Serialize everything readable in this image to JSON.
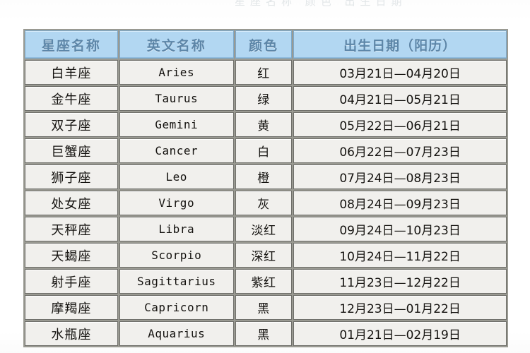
{
  "page": {
    "background_color": "#ffffff",
    "faint_top_text": "星座名称  颜色  出生日期"
  },
  "table": {
    "name": "zodiac-reference-table",
    "header_background_color": "#b2d7f2",
    "header_text_color": "#5d86a8",
    "cell_background_color": "#f1f0ed",
    "cell_text_color": "#14120f",
    "border_color": "#6f6f6a",
    "columns": [
      {
        "key": "name",
        "label": "星座名称"
      },
      {
        "key": "en",
        "label": "英文名称"
      },
      {
        "key": "color",
        "label": "颜色"
      },
      {
        "key": "date",
        "label": "出生日期（阳历）"
      }
    ],
    "rows": [
      {
        "name": "白羊座",
        "en": "Aries",
        "color": "红",
        "date": "03月21日—04月20日"
      },
      {
        "name": "金牛座",
        "en": "Taurus",
        "color": "绿",
        "date": "04月21日—05月21日"
      },
      {
        "name": "双子座",
        "en": "Gemini",
        "color": "黄",
        "date": "05月22日—06月21日"
      },
      {
        "name": "巨蟹座",
        "en": "Cancer",
        "color": "白",
        "date": "06月22日—07月23日"
      },
      {
        "name": "狮子座",
        "en": "Leo",
        "color": "橙",
        "date": "07月24日—08月23日"
      },
      {
        "name": "处女座",
        "en": "Virgo",
        "color": "灰",
        "date": "08月24日—09月23日"
      },
      {
        "name": "天秤座",
        "en": "Libra",
        "color": "淡红",
        "date": "09月24日—10月23日"
      },
      {
        "name": "天蝎座",
        "en": "Scorpio",
        "color": "深红",
        "date": "10月24日—11月22日"
      },
      {
        "name": "射手座",
        "en": "Sagittarius",
        "color": "紫红",
        "date": "11月23日—12月22日"
      },
      {
        "name": "摩羯座",
        "en": "Capricorn",
        "color": "黑",
        "date": "12月23日—01月22日"
      },
      {
        "name": "水瓶座",
        "en": "Aquarius",
        "color": "黑",
        "date": "01月21日—02月19日"
      }
    ]
  }
}
